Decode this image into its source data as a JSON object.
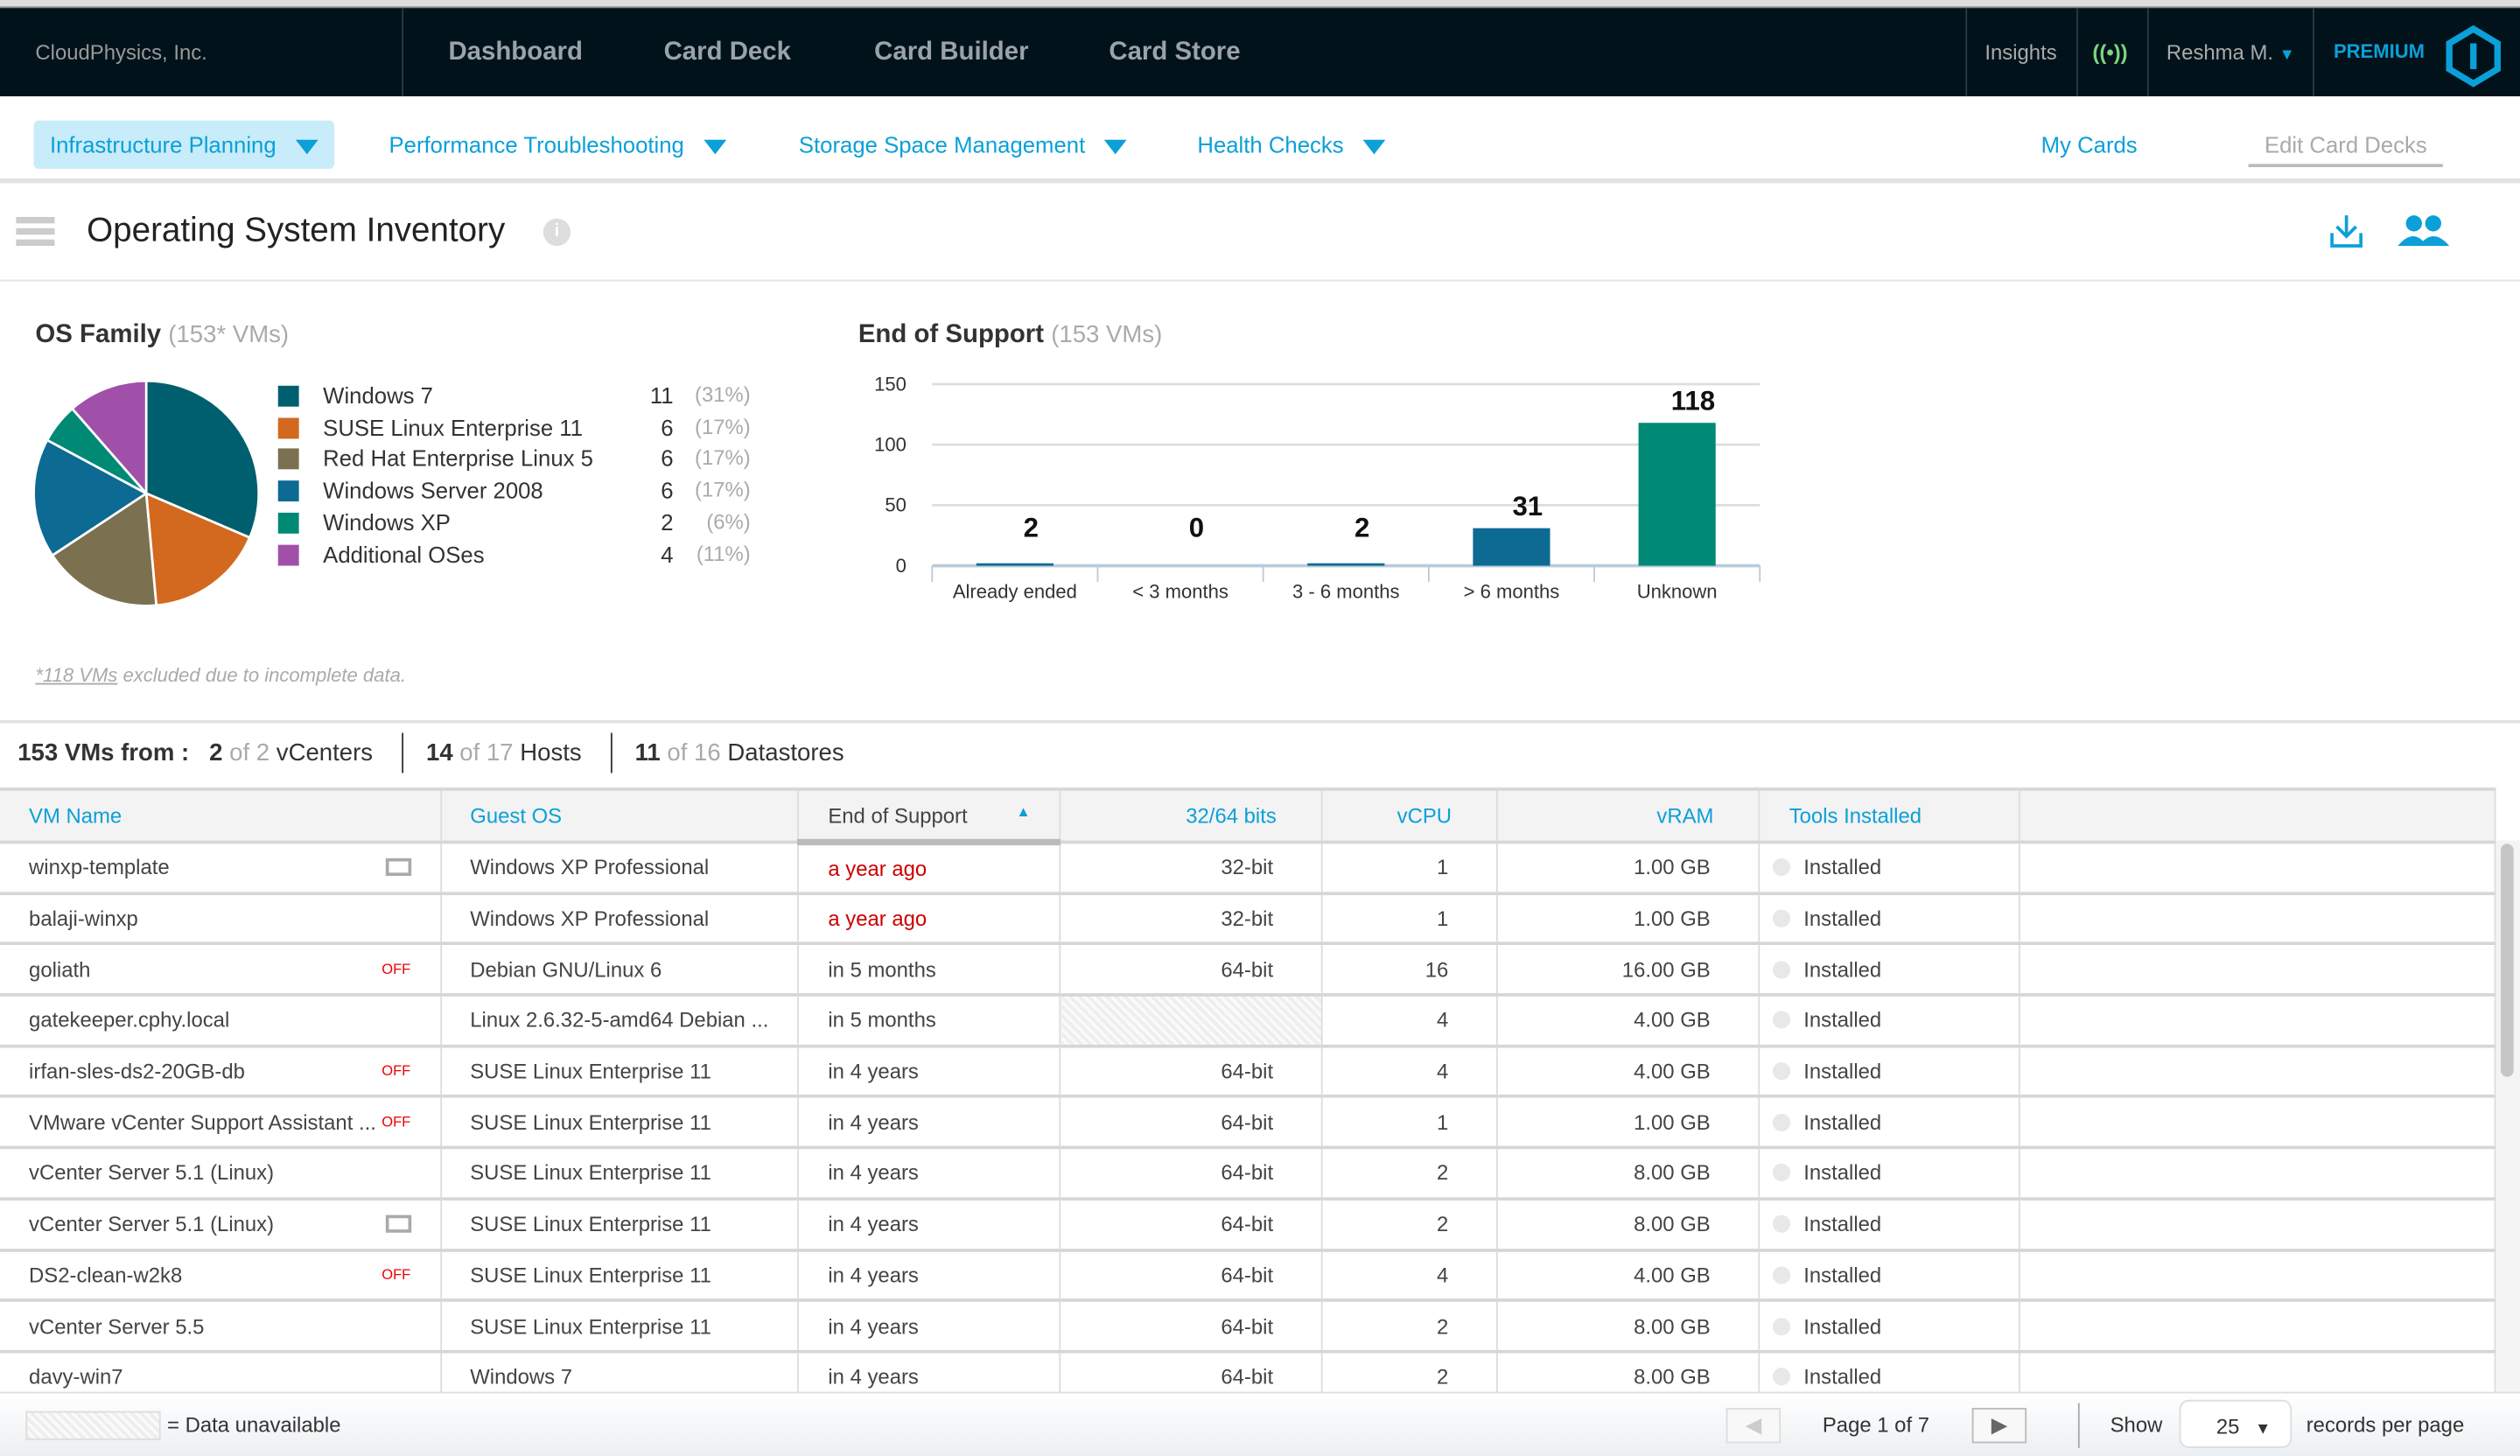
{
  "topbar": {
    "brand": "CloudPhysics, Inc.",
    "nav": [
      "Dashboard",
      "Card Deck",
      "Card Builder",
      "Card Store"
    ],
    "insights": "Insights",
    "user": "Reshma M.",
    "premium": "PREMIUM",
    "accent": "#0ba0d8"
  },
  "subnav": {
    "items": [
      "Infrastructure Planning",
      "Performance Troubleshooting",
      "Storage Space Management",
      "Health Checks"
    ],
    "my_cards": "My Cards",
    "edit_card_decks": "Edit Card Decks"
  },
  "page": {
    "title": "Operating System Inventory"
  },
  "os_family": {
    "title": "OS Family",
    "subtitle": "(153* VMs)",
    "footnote_link": "*118 VMs",
    "footnote": " excluded due to incomplete data."
  },
  "end_of_support": {
    "title": "End of Support",
    "subtitle": "(153 VMs)"
  },
  "chart_data": [
    {
      "type": "pie",
      "title": "OS Family",
      "slices": [
        {
          "name": "Windows 7",
          "value": 11,
          "pct": "(31%)",
          "color": "#005f6e"
        },
        {
          "name": "SUSE Linux Enterprise 11",
          "value": 6,
          "pct": "(17%)",
          "color": "#d2691e"
        },
        {
          "name": "Red Hat Enterprise Linux 5",
          "value": 6,
          "pct": "(17%)",
          "color": "#7b7150"
        },
        {
          "name": "Windows Server 2008",
          "value": 6,
          "pct": "(17%)",
          "color": "#0c6a93"
        },
        {
          "name": "Windows XP",
          "value": 2,
          "pct": "(6%)",
          "color": "#008a76"
        },
        {
          "name": "Additional OSes",
          "value": 4,
          "pct": "(11%)",
          "color": "#a050a8"
        }
      ]
    },
    {
      "type": "bar",
      "title": "End of Support",
      "categories": [
        "Already ended",
        "< 3 months",
        "3 - 6 months",
        "> 6 months",
        "Unknown"
      ],
      "values": [
        2,
        0,
        2,
        31,
        118
      ],
      "colors": [
        "#0c6a93",
        "#0c6a93",
        "#0c6a93",
        "#0c6a93",
        "#008a76"
      ],
      "ylim": [
        0,
        150
      ],
      "yticks": [
        "0",
        "50",
        "100",
        "150"
      ],
      "grid": true
    }
  ],
  "stats": {
    "vms": "153 VMs from :",
    "vcenters": [
      "2",
      "of 2",
      "vCenters"
    ],
    "hosts": [
      "14",
      "of 17",
      "Hosts"
    ],
    "datastores": [
      "11",
      "of 16",
      "Datastores"
    ]
  },
  "table": {
    "columns": [
      "VM Name",
      "Guest OS",
      "End of Support",
      "32/64 bits",
      "vCPU",
      "vRAM",
      "Tools Installed"
    ],
    "rows": [
      {
        "name": "winxp-template",
        "badge": "clone",
        "os": "Windows XP Professional",
        "eos": "a year ago",
        "eos_past": true,
        "bits": "32-bit",
        "vcpu": "1",
        "vram": "1.00 GB",
        "tools": "Installed"
      },
      {
        "name": "balaji-winxp",
        "badge": "",
        "os": "Windows XP Professional",
        "eos": "a year ago",
        "eos_past": true,
        "bits": "32-bit",
        "vcpu": "1",
        "vram": "1.00 GB",
        "tools": "Installed"
      },
      {
        "name": "goliath",
        "badge": "OFF",
        "os": "Debian GNU/Linux 6",
        "eos": "in 5 months",
        "bits": "64-bit",
        "vcpu": "16",
        "vram": "16.00 GB",
        "tools": "Installed"
      },
      {
        "name": "gatekeeper.cphy.local",
        "badge": "",
        "os": "Linux 2.6.32-5-amd64 Debian ...",
        "eos": "in 5 months",
        "bits": "",
        "vcpu": "4",
        "vram": "4.00 GB",
        "tools": "Installed"
      },
      {
        "name": "irfan-sles-ds2-20GB-db",
        "badge": "OFF",
        "os": "SUSE Linux Enterprise 11",
        "eos": "in 4 years",
        "bits": "64-bit",
        "vcpu": "4",
        "vram": "4.00 GB",
        "tools": "Installed"
      },
      {
        "name": "VMware vCenter Support Assistant ...",
        "badge": "OFF",
        "os": "SUSE Linux Enterprise 11",
        "eos": "in 4 years",
        "bits": "64-bit",
        "vcpu": "1",
        "vram": "1.00 GB",
        "tools": "Installed"
      },
      {
        "name": "vCenter Server 5.1 (Linux)",
        "badge": "",
        "os": "SUSE Linux Enterprise 11",
        "eos": "in 4 years",
        "bits": "64-bit",
        "vcpu": "2",
        "vram": "8.00 GB",
        "tools": "Installed"
      },
      {
        "name": "vCenter Server 5.1 (Linux)",
        "badge": "clone",
        "os": "SUSE Linux Enterprise 11",
        "eos": "in 4 years",
        "bits": "64-bit",
        "vcpu": "2",
        "vram": "8.00 GB",
        "tools": "Installed"
      },
      {
        "name": "DS2-clean-w2k8",
        "badge": "OFF",
        "os": "SUSE Linux Enterprise 11",
        "eos": "in 4 years",
        "bits": "64-bit",
        "vcpu": "4",
        "vram": "4.00 GB",
        "tools": "Installed"
      },
      {
        "name": "vCenter Server 5.5",
        "badge": "",
        "os": "SUSE Linux Enterprise 11",
        "eos": "in 4 years",
        "bits": "64-bit",
        "vcpu": "2",
        "vram": "8.00 GB",
        "tools": "Installed"
      },
      {
        "name": "davy-win7",
        "badge": "",
        "os": "Windows 7",
        "eos": "in 4 years",
        "bits": "64-bit",
        "vcpu": "2",
        "vram": "8.00 GB",
        "tools": "Installed"
      }
    ]
  },
  "footer": {
    "legend": "= Data unavailable",
    "page": "Page 1 of 7",
    "show": "Show",
    "per_page": "25",
    "records": "records per page"
  }
}
